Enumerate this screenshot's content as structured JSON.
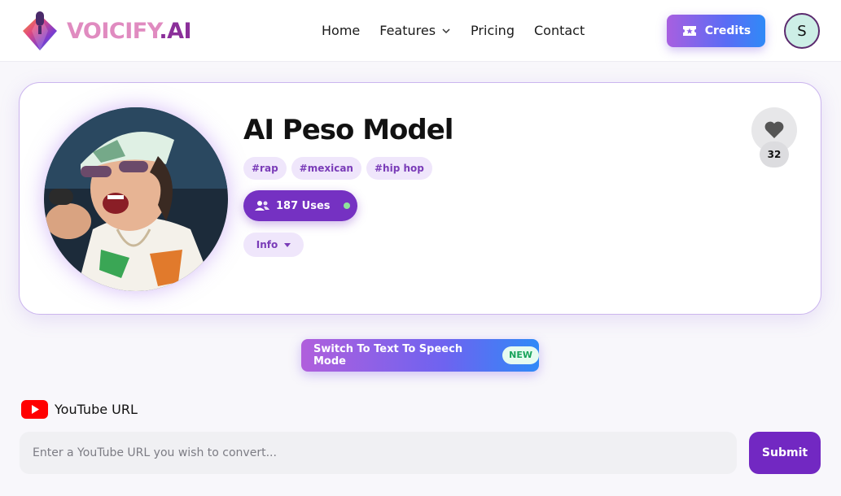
{
  "header": {
    "logo_text": "VOICIFY",
    "logo_suffix": ".AI",
    "nav": [
      {
        "label": "Home"
      },
      {
        "label": "Features",
        "has_dropdown": true
      },
      {
        "label": "Pricing"
      },
      {
        "label": "Contact"
      }
    ],
    "credits_label": "Credits",
    "avatar_initial": "S"
  },
  "model": {
    "title": "AI Peso Model",
    "tags": [
      "#rap",
      "#mexican",
      "#hip hop"
    ],
    "uses_label": "187 Uses",
    "info_label": "Info",
    "likes": "32"
  },
  "switch": {
    "label": "Switch To Text To Speech Mode",
    "badge": "NEW"
  },
  "youtube": {
    "label": "YouTube URL",
    "placeholder": "Enter a YouTube URL you wish to convert...",
    "value": "",
    "submit_label": "Submit"
  },
  "colors": {
    "accent": "#7531c2",
    "gradient_start": "#b05fdc",
    "gradient_end": "#2f8af7",
    "tag_bg": "#efe6fb",
    "tag_text": "#7a3cb8",
    "new_badge": "#18a35a",
    "youtube_red": "#ff0000"
  },
  "icons": {
    "logo": "diamond-microphone-icon",
    "credits": "ticket-icon",
    "uses": "users-icon",
    "like": "heart-icon",
    "youtube": "youtube-icon"
  }
}
